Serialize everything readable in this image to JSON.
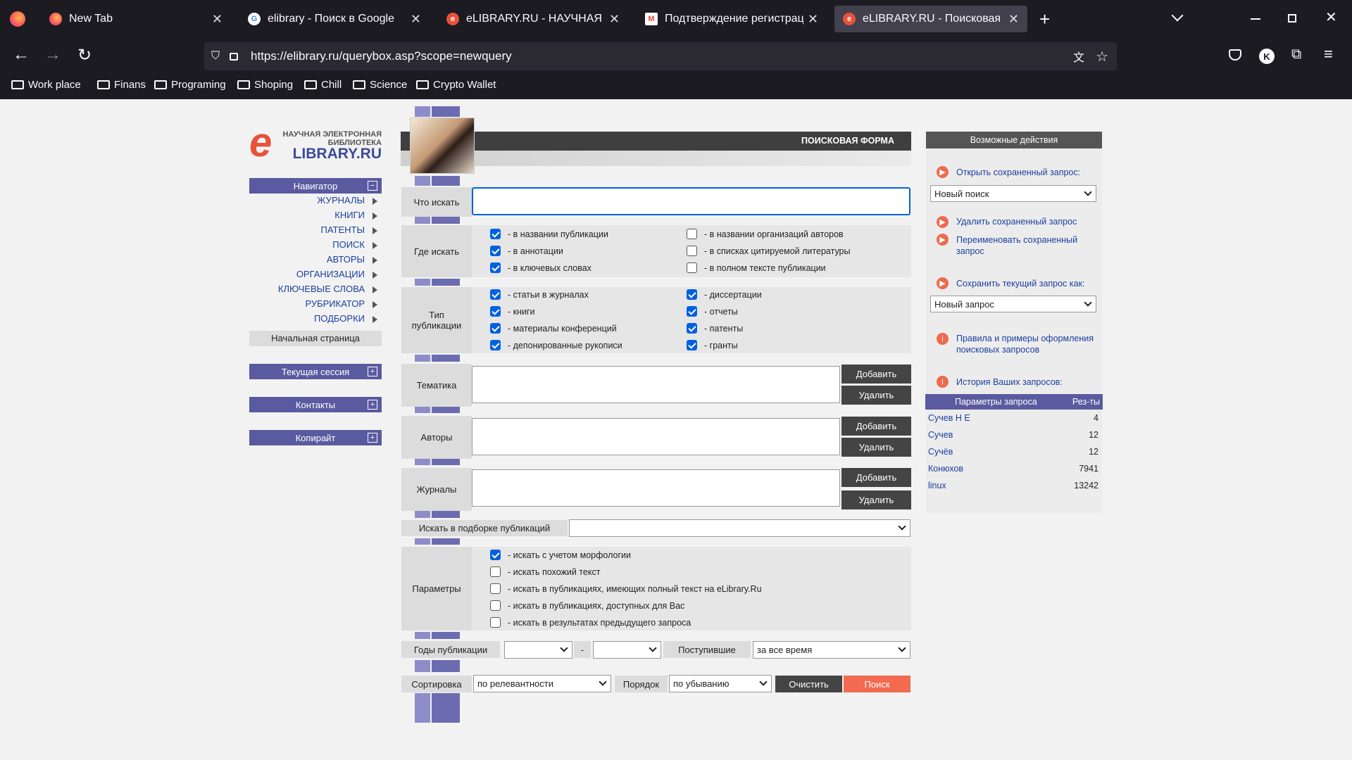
{
  "browser": {
    "tabs": [
      {
        "title": "New Tab"
      },
      {
        "title": "elibrary - Поиск в Google"
      },
      {
        "title": "eLIBRARY.RU - НАУЧНАЯ ЭЛЕК"
      },
      {
        "title": "Подтверждение регистрации"
      },
      {
        "title": "eLIBRARY.RU - Поисковая фор"
      }
    ],
    "url": "https://elibrary.ru/querybox.asp?scope=newquery",
    "bookmarks": [
      "Work place",
      "Finans",
      "Programing",
      "Shoping",
      "Chill",
      "Science",
      "Crypto Wallet"
    ],
    "profile_initial": "K"
  },
  "logo": {
    "line1": "НАУЧНАЯ ЭЛЕКТРОННАЯ",
    "line2": "БИБЛИОТЕКА",
    "name": "LIBRARY.RU",
    "e": "e"
  },
  "sidebar": {
    "navigator": "Навигатор",
    "items": [
      "ЖУРНАЛЫ",
      "КНИГИ",
      "ПАТЕНТЫ",
      "ПОИСК",
      "АВТОРЫ",
      "ОРГАНИЗАЦИИ",
      "КЛЮЧЕВЫЕ СЛОВА",
      "РУБРИКАТОР",
      "ПОДБОРКИ"
    ],
    "home": "Начальная страница",
    "session": "Текущая сессия",
    "contacts": "Контакты",
    "copyright": "Копирайт"
  },
  "form": {
    "title": "ПОИСКОВАЯ ФОРМА",
    "what_label": "Что искать",
    "what_value": "",
    "where_label": "Где искать",
    "where": [
      {
        "label": "- в названии публикации",
        "checked": true
      },
      {
        "label": "- в аннотации",
        "checked": true
      },
      {
        "label": "- в ключевых словах",
        "checked": true
      },
      {
        "label": "- в названии организаций авторов",
        "checked": false
      },
      {
        "label": "- в списках цитируемой литературы",
        "checked": false
      },
      {
        "label": "- в полном тексте публикации",
        "checked": false
      }
    ],
    "type_label": "Тип публикации",
    "types": [
      {
        "label": "- статьи в журналах",
        "checked": true
      },
      {
        "label": "- книги",
        "checked": true
      },
      {
        "label": "- материалы конференций",
        "checked": true
      },
      {
        "label": "- депонированные рукописи",
        "checked": true
      },
      {
        "label": "- диссертации",
        "checked": true
      },
      {
        "label": "- отчеты",
        "checked": true
      },
      {
        "label": "- патенты",
        "checked": true
      },
      {
        "label": "- гранты",
        "checked": true
      }
    ],
    "topics_label": "Тематика",
    "authors_label": "Авторы",
    "journals_label": "Журналы",
    "add": "Добавить",
    "remove": "Удалить",
    "collection_label": "Искать в подборке публикаций",
    "collection_value": "",
    "params_label": "Параметры",
    "params": [
      {
        "label": "- искать с учетом морфологии",
        "checked": true
      },
      {
        "label": "- искать похожий текст",
        "checked": false
      },
      {
        "label": "- искать в публикациях, имеющих полный текст на eLibrary.Ru",
        "checked": false
      },
      {
        "label": "- искать в публикациях, доступных для Вас",
        "checked": false
      },
      {
        "label": "- искать в результатах предыдущего запроса",
        "checked": false
      }
    ],
    "years_label": "Годы публикации",
    "year_from": "",
    "year_dash": "-",
    "year_to": "",
    "received_label": "Поступившие",
    "received_value": "за все время",
    "sort_label": "Сортировка",
    "sort_value": "по релевантности",
    "order_label": "Порядок",
    "order_value": "по убыванию",
    "clear": "Очистить",
    "search": "Поиск"
  },
  "actions": {
    "title": "Возможные действия",
    "open_saved": "Открыть сохраненный запрос:",
    "open_select": "Новый поиск",
    "delete_saved": "Удалить сохраненный запрос",
    "rename_saved": "Переименовать сохраненный запрос",
    "save_as": "Сохранить текущий запрос как:",
    "save_select": "Новый запрос",
    "rules": "Правила и примеры оформления поисковых запросов",
    "history_title": "История Ваших запросов:",
    "history_col1": "Параметры запроса",
    "history_col2": "Рез-ты",
    "history": [
      {
        "q": "Сучев Н Е",
        "n": "4"
      },
      {
        "q": "Сучев",
        "n": "12"
      },
      {
        "q": "Сучёв",
        "n": "12"
      },
      {
        "q": "Конюхов",
        "n": "7941"
      },
      {
        "q": "linux",
        "n": "13242"
      }
    ]
  },
  "colors": {
    "accent": "#5a5aa0",
    "search": "#f26a4f",
    "dark": "#444444",
    "logo": "#e8523a"
  }
}
